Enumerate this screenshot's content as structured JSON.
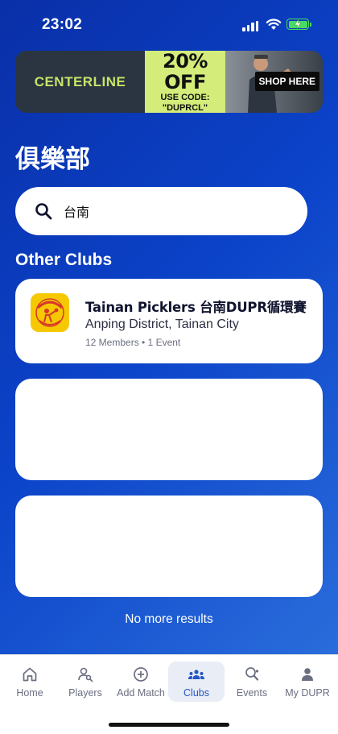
{
  "status_bar": {
    "time": "23:02"
  },
  "ad": {
    "brand": "CENTERLINE",
    "offer": "20% OFF",
    "code_line1": "USE CODE:",
    "code_line2": "\"DUPRCL\"",
    "cta": "SHOP HERE"
  },
  "page": {
    "title": "俱樂部"
  },
  "search": {
    "value": "台南"
  },
  "section": {
    "title": "Other Clubs"
  },
  "clubs": [
    {
      "name": "Tainan Picklers 台南DUPR循環賽",
      "location": "Anping District, Tainan City",
      "meta": "12 Members • 1 Event"
    }
  ],
  "end_message": "No more results",
  "tabs": [
    {
      "label": "Home",
      "icon": "home-icon"
    },
    {
      "label": "Players",
      "icon": "players-icon"
    },
    {
      "label": "Add Match",
      "icon": "add-circle-icon"
    },
    {
      "label": "Clubs",
      "icon": "clubs-icon",
      "active": true
    },
    {
      "label": "Events",
      "icon": "events-icon"
    },
    {
      "label": "My DUPR",
      "icon": "profile-icon"
    }
  ],
  "colors": {
    "accent": "#2557c6",
    "background_start": "#0a2fa8",
    "background_end": "#2f73de",
    "ad_lime": "#d3ec7a",
    "battery": "#4cd964"
  }
}
